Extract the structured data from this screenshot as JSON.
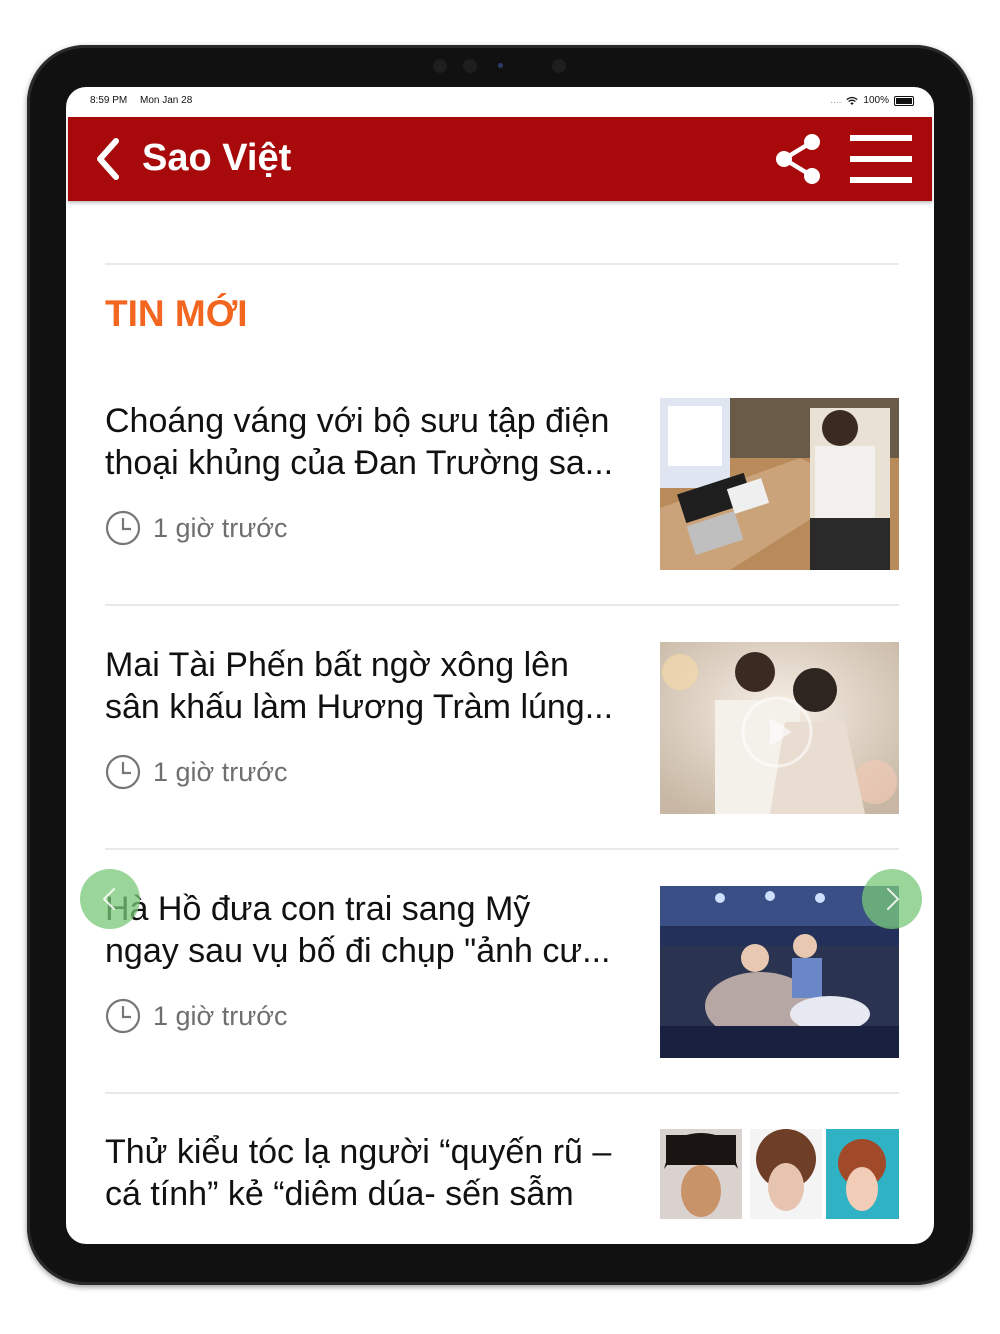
{
  "status_bar": {
    "time": "8:59 PM",
    "date": "Mon Jan 28",
    "signal": "....",
    "battery": "100%"
  },
  "app_bar": {
    "title": "Sao Việt",
    "back_icon": "chevron-left-icon",
    "share_icon": "share-icon",
    "menu_icon": "hamburger-menu-icon",
    "background_color": "#a80a0c"
  },
  "section": {
    "title": "TIN MỚI",
    "title_color": "#f3661f"
  },
  "articles": [
    {
      "title_line1": "Choáng váng với bộ sưu tập điện",
      "title_line2": "thoại khủng của Đan Trường sa...",
      "time": "1 giờ trước"
    },
    {
      "title_line1": "Mai Tài Phến bất ngờ xông lên",
      "title_line2": "sân khấu làm Hương Tràm lúng...",
      "time": "1 giờ trước"
    },
    {
      "title_line1": "Hà Hồ đưa con trai sang Mỹ",
      "title_line2": "ngay sau vụ bố đi chụp \"ảnh cư...",
      "time": "1 giờ trước"
    },
    {
      "title_line1": "Thử kiểu tóc lạ người “quyến rũ –",
      "title_line2": "cá tính” kẻ “diêm dúa- sến sẫm",
      "time": ""
    }
  ],
  "carousel": {
    "prev_icon": "chevron-left-icon",
    "next_icon": "chevron-right-icon"
  }
}
